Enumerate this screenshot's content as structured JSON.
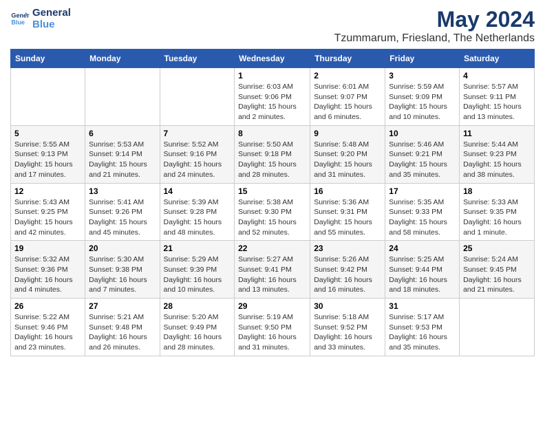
{
  "logo": {
    "line1": "General",
    "line2": "Blue"
  },
  "title": "May 2024",
  "location": "Tzummarum, Friesland, The Netherlands",
  "days_header": [
    "Sunday",
    "Monday",
    "Tuesday",
    "Wednesday",
    "Thursday",
    "Friday",
    "Saturday"
  ],
  "weeks": [
    [
      {
        "day": "",
        "info": ""
      },
      {
        "day": "",
        "info": ""
      },
      {
        "day": "",
        "info": ""
      },
      {
        "day": "1",
        "info": "Sunrise: 6:03 AM\nSunset: 9:06 PM\nDaylight: 15 hours\nand 2 minutes."
      },
      {
        "day": "2",
        "info": "Sunrise: 6:01 AM\nSunset: 9:07 PM\nDaylight: 15 hours\nand 6 minutes."
      },
      {
        "day": "3",
        "info": "Sunrise: 5:59 AM\nSunset: 9:09 PM\nDaylight: 15 hours\nand 10 minutes."
      },
      {
        "day": "4",
        "info": "Sunrise: 5:57 AM\nSunset: 9:11 PM\nDaylight: 15 hours\nand 13 minutes."
      }
    ],
    [
      {
        "day": "5",
        "info": "Sunrise: 5:55 AM\nSunset: 9:13 PM\nDaylight: 15 hours\nand 17 minutes."
      },
      {
        "day": "6",
        "info": "Sunrise: 5:53 AM\nSunset: 9:14 PM\nDaylight: 15 hours\nand 21 minutes."
      },
      {
        "day": "7",
        "info": "Sunrise: 5:52 AM\nSunset: 9:16 PM\nDaylight: 15 hours\nand 24 minutes."
      },
      {
        "day": "8",
        "info": "Sunrise: 5:50 AM\nSunset: 9:18 PM\nDaylight: 15 hours\nand 28 minutes."
      },
      {
        "day": "9",
        "info": "Sunrise: 5:48 AM\nSunset: 9:20 PM\nDaylight: 15 hours\nand 31 minutes."
      },
      {
        "day": "10",
        "info": "Sunrise: 5:46 AM\nSunset: 9:21 PM\nDaylight: 15 hours\nand 35 minutes."
      },
      {
        "day": "11",
        "info": "Sunrise: 5:44 AM\nSunset: 9:23 PM\nDaylight: 15 hours\nand 38 minutes."
      }
    ],
    [
      {
        "day": "12",
        "info": "Sunrise: 5:43 AM\nSunset: 9:25 PM\nDaylight: 15 hours\nand 42 minutes."
      },
      {
        "day": "13",
        "info": "Sunrise: 5:41 AM\nSunset: 9:26 PM\nDaylight: 15 hours\nand 45 minutes."
      },
      {
        "day": "14",
        "info": "Sunrise: 5:39 AM\nSunset: 9:28 PM\nDaylight: 15 hours\nand 48 minutes."
      },
      {
        "day": "15",
        "info": "Sunrise: 5:38 AM\nSunset: 9:30 PM\nDaylight: 15 hours\nand 52 minutes."
      },
      {
        "day": "16",
        "info": "Sunrise: 5:36 AM\nSunset: 9:31 PM\nDaylight: 15 hours\nand 55 minutes."
      },
      {
        "day": "17",
        "info": "Sunrise: 5:35 AM\nSunset: 9:33 PM\nDaylight: 15 hours\nand 58 minutes."
      },
      {
        "day": "18",
        "info": "Sunrise: 5:33 AM\nSunset: 9:35 PM\nDaylight: 16 hours\nand 1 minute."
      }
    ],
    [
      {
        "day": "19",
        "info": "Sunrise: 5:32 AM\nSunset: 9:36 PM\nDaylight: 16 hours\nand 4 minutes."
      },
      {
        "day": "20",
        "info": "Sunrise: 5:30 AM\nSunset: 9:38 PM\nDaylight: 16 hours\nand 7 minutes."
      },
      {
        "day": "21",
        "info": "Sunrise: 5:29 AM\nSunset: 9:39 PM\nDaylight: 16 hours\nand 10 minutes."
      },
      {
        "day": "22",
        "info": "Sunrise: 5:27 AM\nSunset: 9:41 PM\nDaylight: 16 hours\nand 13 minutes."
      },
      {
        "day": "23",
        "info": "Sunrise: 5:26 AM\nSunset: 9:42 PM\nDaylight: 16 hours\nand 16 minutes."
      },
      {
        "day": "24",
        "info": "Sunrise: 5:25 AM\nSunset: 9:44 PM\nDaylight: 16 hours\nand 18 minutes."
      },
      {
        "day": "25",
        "info": "Sunrise: 5:24 AM\nSunset: 9:45 PM\nDaylight: 16 hours\nand 21 minutes."
      }
    ],
    [
      {
        "day": "26",
        "info": "Sunrise: 5:22 AM\nSunset: 9:46 PM\nDaylight: 16 hours\nand 23 minutes."
      },
      {
        "day": "27",
        "info": "Sunrise: 5:21 AM\nSunset: 9:48 PM\nDaylight: 16 hours\nand 26 minutes."
      },
      {
        "day": "28",
        "info": "Sunrise: 5:20 AM\nSunset: 9:49 PM\nDaylight: 16 hours\nand 28 minutes."
      },
      {
        "day": "29",
        "info": "Sunrise: 5:19 AM\nSunset: 9:50 PM\nDaylight: 16 hours\nand 31 minutes."
      },
      {
        "day": "30",
        "info": "Sunrise: 5:18 AM\nSunset: 9:52 PM\nDaylight: 16 hours\nand 33 minutes."
      },
      {
        "day": "31",
        "info": "Sunrise: 5:17 AM\nSunset: 9:53 PM\nDaylight: 16 hours\nand 35 minutes."
      },
      {
        "day": "",
        "info": ""
      }
    ]
  ]
}
